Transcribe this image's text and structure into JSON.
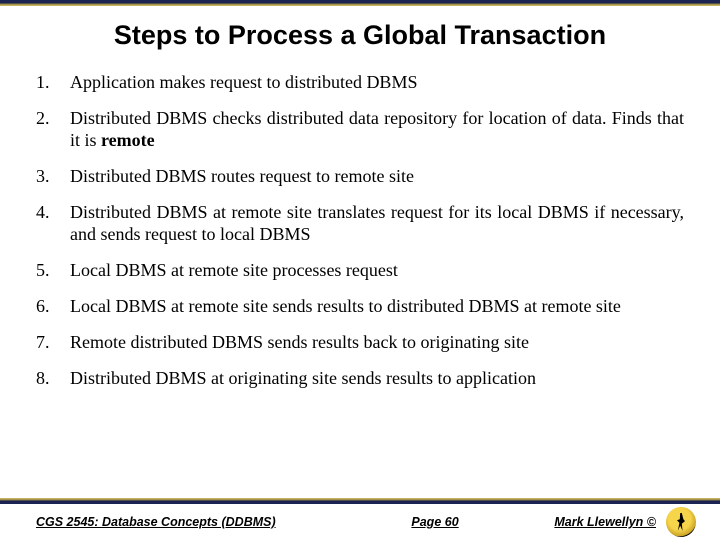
{
  "title": "Steps to Process a Global Transaction",
  "steps": [
    {
      "num": "1.",
      "text": "Application makes request to distributed DBMS"
    },
    {
      "num": "2.",
      "text": "Distributed DBMS checks distributed data repository for location of data. Finds that it is <b>remote</b>"
    },
    {
      "num": "3.",
      "text": "Distributed DBMS routes request to remote site"
    },
    {
      "num": "4.",
      "text": "Distributed DBMS at remote site translates request for its local DBMS if necessary, and sends request to local DBMS"
    },
    {
      "num": "5.",
      "text": "Local DBMS at remote site processes request"
    },
    {
      "num": "6.",
      "text": "Local DBMS at remote site sends results to distributed DBMS at remote site"
    },
    {
      "num": "7.",
      "text": "Remote distributed DBMS sends results back to originating site"
    },
    {
      "num": "8.",
      "text": "Distributed DBMS at originating site sends results to application"
    }
  ],
  "footer": {
    "course": "CGS 2545: Database Concepts (DDBMS)",
    "page": "Page 60",
    "author": "Mark Llewellyn ©"
  }
}
